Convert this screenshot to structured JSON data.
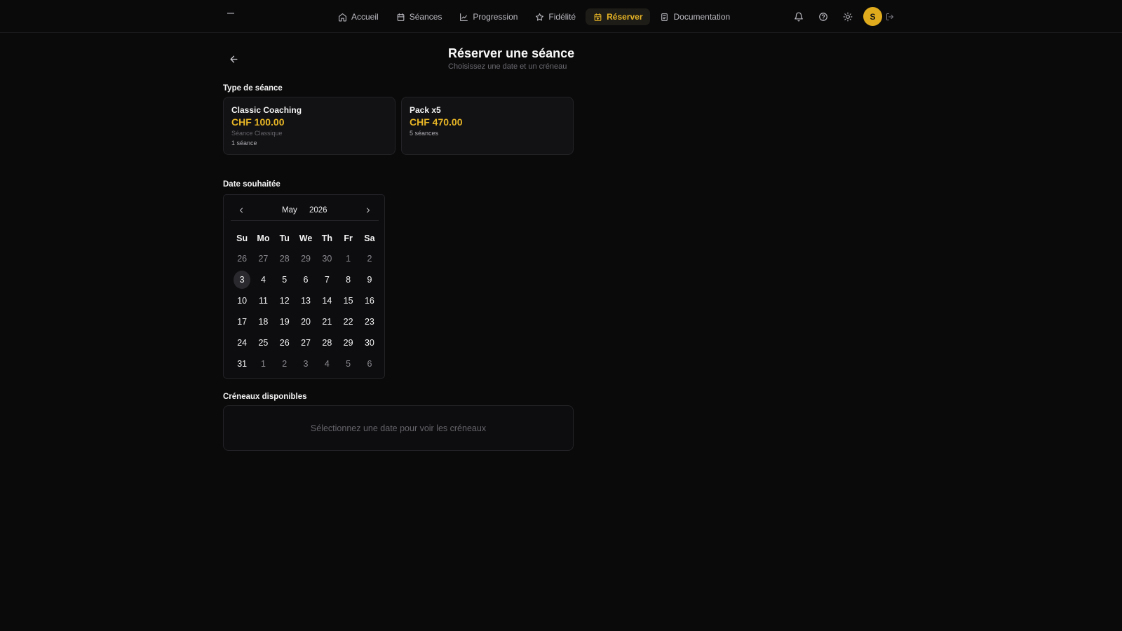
{
  "nav": {
    "items": [
      {
        "label": "Accueil",
        "icon": "home-icon",
        "active": false
      },
      {
        "label": "Séances",
        "icon": "calendar-icon",
        "active": false
      },
      {
        "label": "Progression",
        "icon": "chart-line-icon",
        "active": false
      },
      {
        "label": "Fidélité",
        "icon": "star-icon",
        "active": false
      },
      {
        "label": "Réserver",
        "icon": "calendar-plus-icon",
        "active": true
      },
      {
        "label": "Documentation",
        "icon": "document-icon",
        "active": false
      }
    ],
    "avatar_initial": "S",
    "accent_color": "#e7b526"
  },
  "header": {
    "title": "Réserver une séance",
    "subtitle": "Choisissez une date et un créneau"
  },
  "session_type": {
    "label": "Type de séance",
    "options": [
      {
        "name": "Classic Coaching",
        "price": "CHF 100.00",
        "description": "Séance Classique",
        "count": "1 séance"
      },
      {
        "name": "Pack x5",
        "price": "CHF 470.00",
        "description": "",
        "count": "5 séances"
      }
    ]
  },
  "date": {
    "label": "Date souhaitée",
    "month": "May",
    "year": "2026",
    "weekdays": [
      "Su",
      "Mo",
      "Tu",
      "We",
      "Th",
      "Fr",
      "Sa"
    ],
    "weeks": [
      [
        {
          "d": "26",
          "out": true
        },
        {
          "d": "27",
          "out": true
        },
        {
          "d": "28",
          "out": true
        },
        {
          "d": "29",
          "out": true
        },
        {
          "d": "30",
          "out": true
        },
        {
          "d": "1",
          "out": true
        },
        {
          "d": "2",
          "out": true
        }
      ],
      [
        {
          "d": "3",
          "today": true
        },
        {
          "d": "4"
        },
        {
          "d": "5"
        },
        {
          "d": "6"
        },
        {
          "d": "7"
        },
        {
          "d": "8"
        },
        {
          "d": "9"
        }
      ],
      [
        {
          "d": "10"
        },
        {
          "d": "11"
        },
        {
          "d": "12"
        },
        {
          "d": "13"
        },
        {
          "d": "14"
        },
        {
          "d": "15"
        },
        {
          "d": "16"
        }
      ],
      [
        {
          "d": "17"
        },
        {
          "d": "18"
        },
        {
          "d": "19"
        },
        {
          "d": "20"
        },
        {
          "d": "21"
        },
        {
          "d": "22"
        },
        {
          "d": "23"
        }
      ],
      [
        {
          "d": "24"
        },
        {
          "d": "25"
        },
        {
          "d": "26"
        },
        {
          "d": "27"
        },
        {
          "d": "28"
        },
        {
          "d": "29"
        },
        {
          "d": "30"
        }
      ],
      [
        {
          "d": "31"
        },
        {
          "d": "1",
          "out": true
        },
        {
          "d": "2",
          "out": true
        },
        {
          "d": "3",
          "out": true
        },
        {
          "d": "4",
          "out": true
        },
        {
          "d": "5",
          "out": true
        },
        {
          "d": "6",
          "out": true
        }
      ]
    ]
  },
  "slots": {
    "label": "Créneaux disponibles",
    "empty_text": "Sélectionnez une date pour voir les créneaux"
  }
}
